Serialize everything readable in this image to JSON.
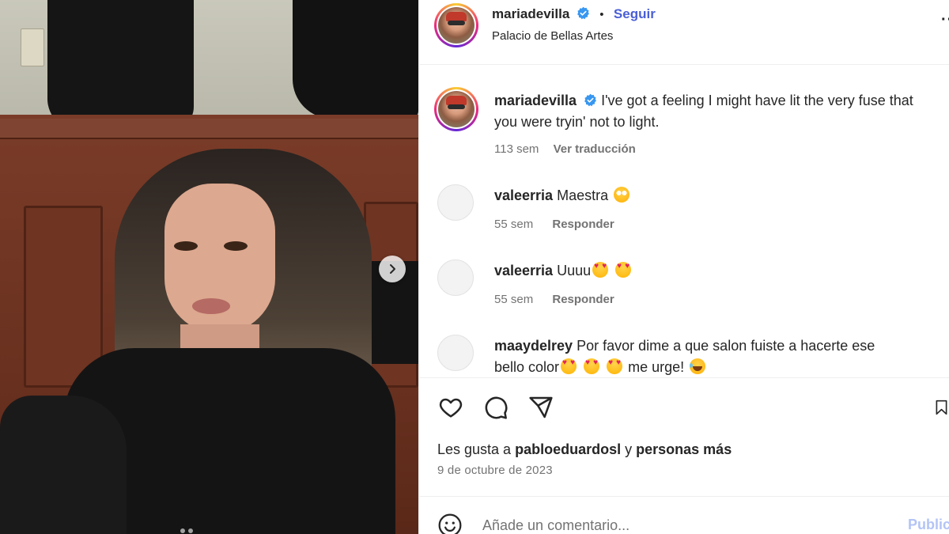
{
  "header": {
    "username": "mariadevilla",
    "dot": "•",
    "follow_label": "Seguir",
    "location": "Palacio de Bellas Artes",
    "more": "···"
  },
  "caption": {
    "username": "mariadevilla",
    "text_line1": "I've got a feeling I might have lit the very fuse that",
    "text_line2": "you were tryin' not to light.",
    "age": "113 sem",
    "translate_label": "Ver traducción"
  },
  "comments": [
    {
      "username": "valeerria",
      "text": "Maestra",
      "age": "55 sem",
      "reply_label": "Responder"
    },
    {
      "username": "valeerria",
      "text": "Uuuu",
      "age": "55 sem",
      "reply_label": "Responder"
    },
    {
      "username": "maaydelrey",
      "text_line1": "Por favor dime a que salon fuiste a hacerte ese",
      "text_line2_a": "bello color",
      "text_line2_b": "me urge!"
    }
  ],
  "likes": {
    "prefix": "Les gusta a",
    "user": "pabloeduardosl",
    "connector": "y",
    "others": "personas más"
  },
  "date": "9 de octubre de 2023",
  "comment_box": {
    "placeholder": "Añade un comentario...",
    "publish_label": "Publicar"
  },
  "colors": {
    "accent": "#4a5fd6",
    "verified": "#3897f0",
    "publish_disabled": "#b3c4f5"
  }
}
